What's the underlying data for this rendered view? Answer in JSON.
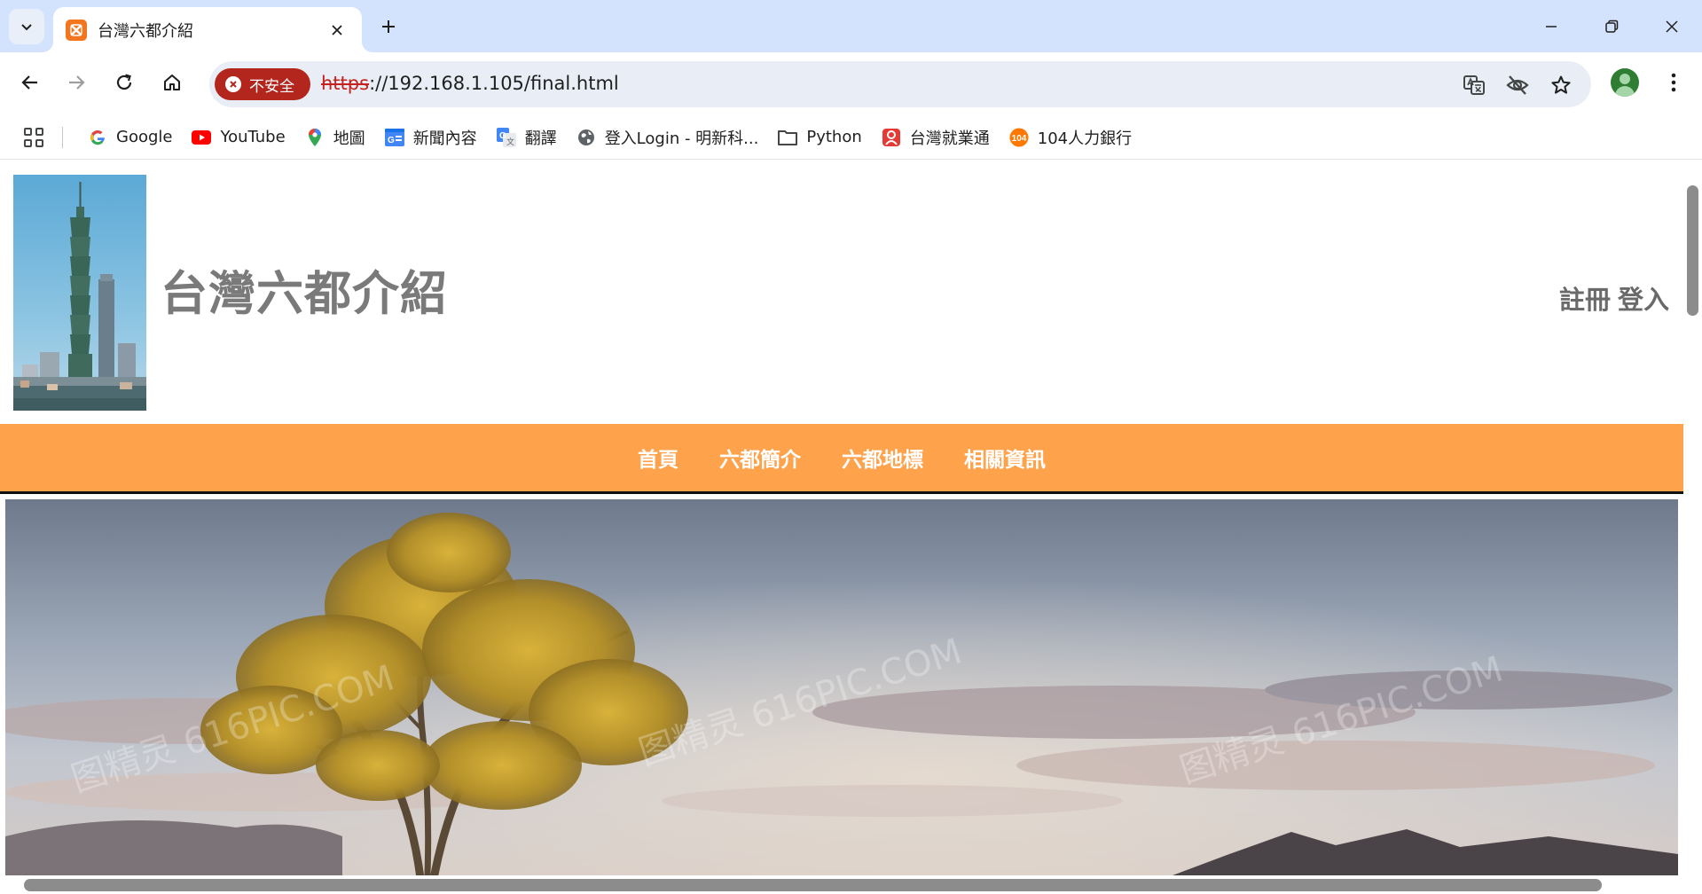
{
  "browser": {
    "tab": {
      "title": "台灣六都介紹",
      "favicon": "xampp-icon"
    },
    "window_controls": [
      "minimize",
      "restore",
      "close"
    ],
    "address_bar": {
      "security_label": "不安全",
      "url_scheme": "https",
      "url_rest": "://192.168.1.105/final.html"
    },
    "bookmarks": [
      {
        "label": "Google",
        "icon": "google-icon"
      },
      {
        "label": "YouTube",
        "icon": "youtube-icon"
      },
      {
        "label": "地圖",
        "icon": "maps-icon"
      },
      {
        "label": "新聞內容",
        "icon": "news-icon"
      },
      {
        "label": "翻譯",
        "icon": "translate-icon"
      },
      {
        "label": "登入Login - 明新科...",
        "icon": "globe-icon"
      },
      {
        "label": "Python",
        "icon": "folder-icon"
      },
      {
        "label": "台灣就業通",
        "icon": "job-icon"
      },
      {
        "label": "104人力銀行",
        "icon": "104-icon"
      }
    ]
  },
  "page": {
    "site_title": "台灣六都介紹",
    "auth": {
      "register": "註冊",
      "login": "登入"
    },
    "nav": [
      {
        "label": "首頁"
      },
      {
        "label": "六都簡介"
      },
      {
        "label": "六都地標"
      },
      {
        "label": "相關資訊"
      }
    ],
    "banner_watermark": "图精灵 616PIC.COM"
  },
  "colors": {
    "nav_bar": "#ffa24c",
    "title_gray": "#7a7a7a",
    "security_red": "#b3261e",
    "tabstrip": "#d3e3fd"
  }
}
